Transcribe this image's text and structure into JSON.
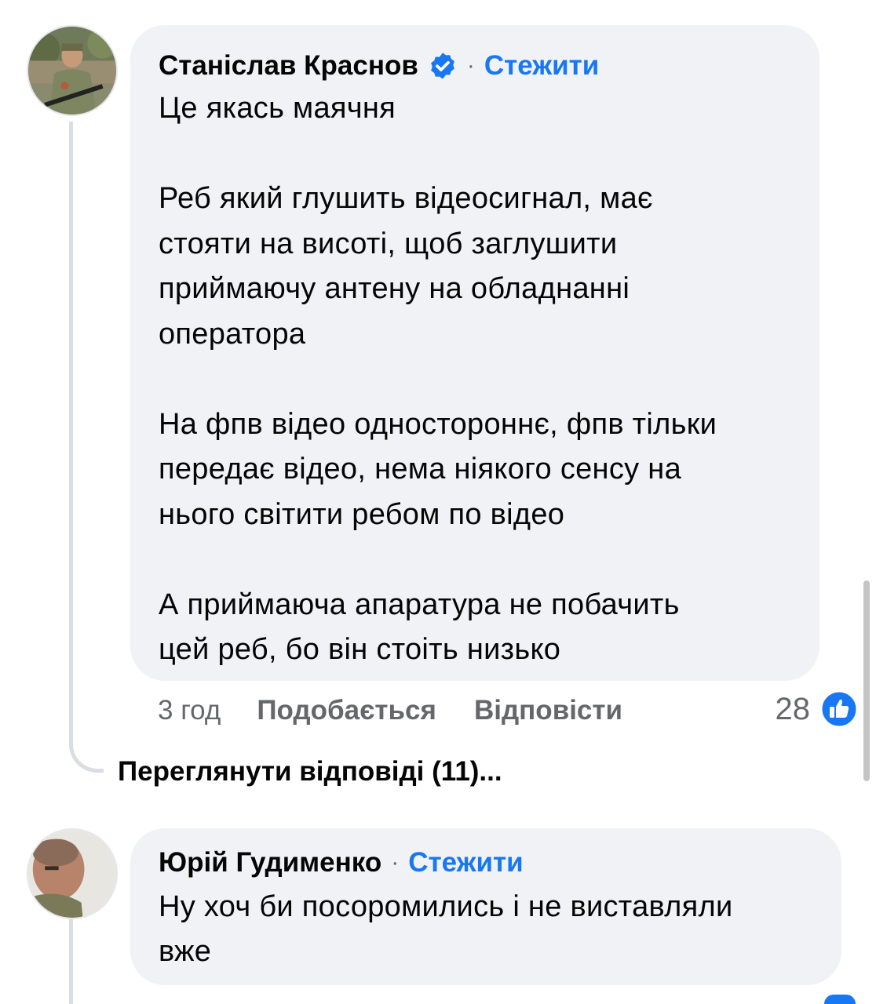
{
  "comments": [
    {
      "author": "Станіслав Краснов",
      "verified": true,
      "follow_label": "Стежити",
      "separator": "·",
      "text": "Це якась маячня\n\nРеб який глушить відеосигнал, має\nстояти на висоті, щоб заглушити\nприймаючу антену на обладнанні\nоператора\n\nНа фпв відео одностороннє, фпв тільки\nпередає відео, нема ніякого сенсу на\nнього світити ребом по відео\n\nА приймаюча апаратура не побачить\nцей реб, бо він стоіть низько",
      "time": "3 год",
      "like_label": "Подобається",
      "reply_label": "Відповісти",
      "reaction_count": "28",
      "reaction_icon": "like-icon",
      "view_replies_label": "Переглянути відповіді (11)..."
    },
    {
      "author": "Юрій Гудименко",
      "verified": false,
      "follow_label": "Стежити",
      "separator": "·",
      "text": "Ну хоч би посоромились і не виставляли\nвже"
    }
  ],
  "colors": {
    "bubble": "#f0f2f5",
    "link": "#1877f2",
    "secondary_text": "#65676b",
    "thread_line": "#dadde1"
  }
}
